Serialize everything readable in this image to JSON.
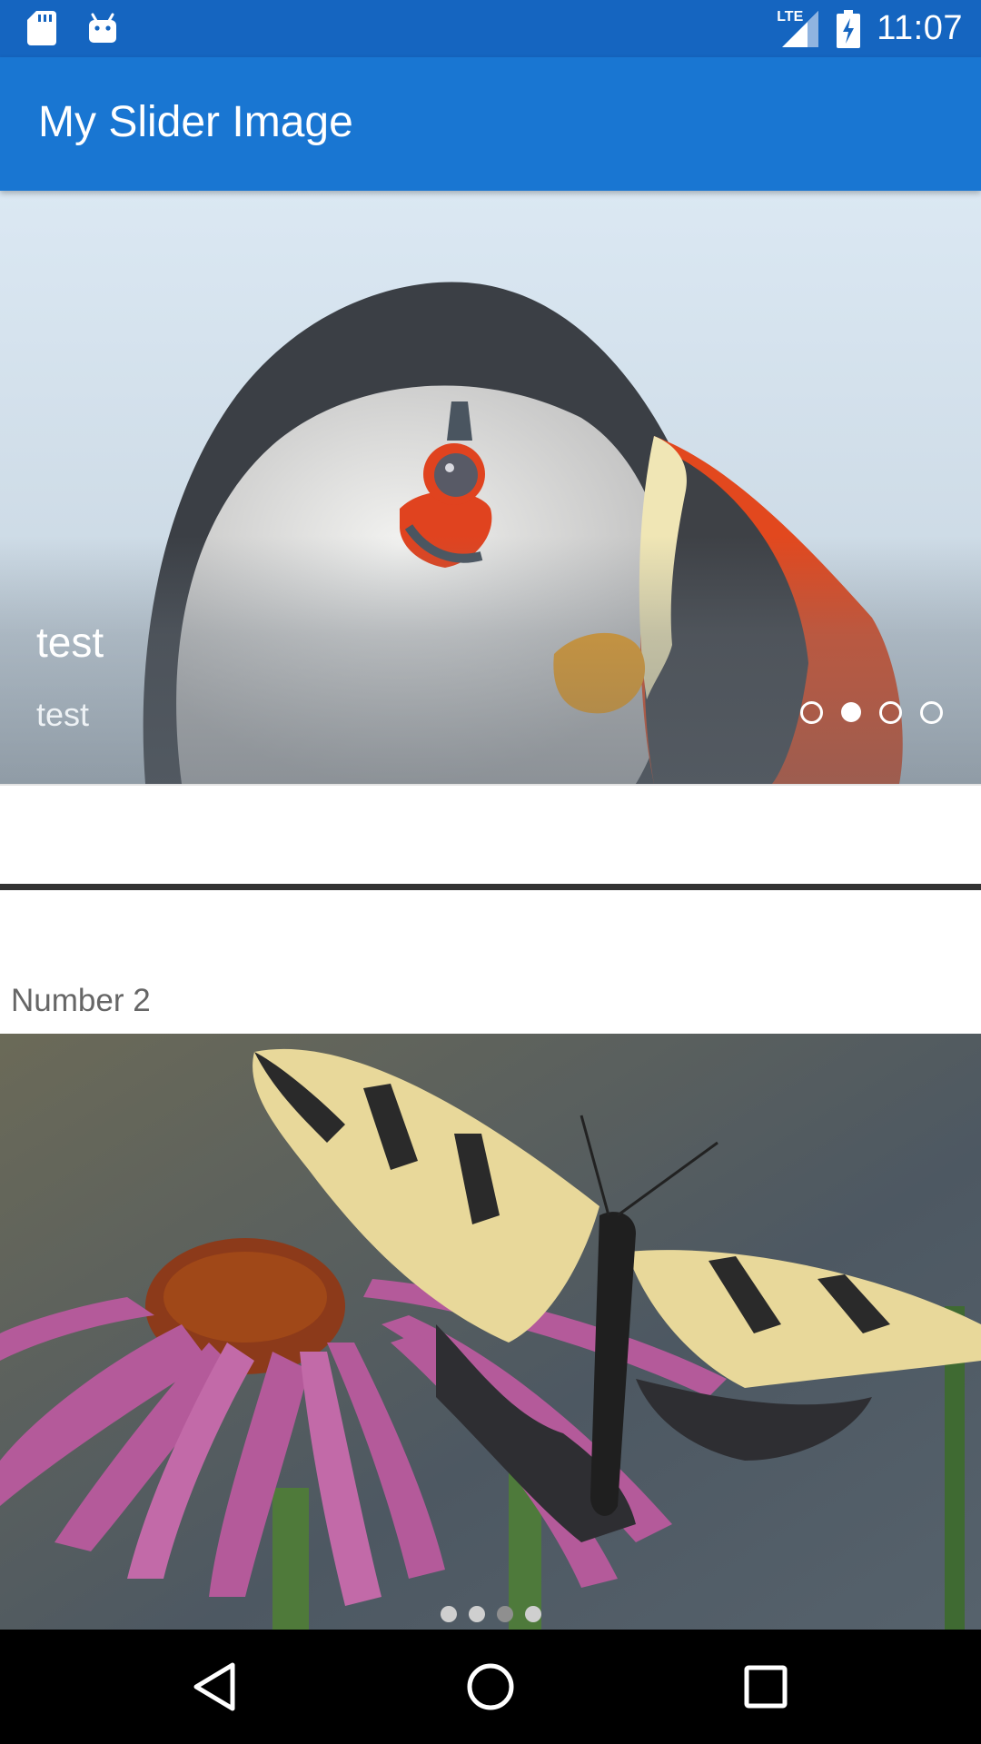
{
  "status_bar": {
    "time": "11:07",
    "network": "LTE",
    "icons": [
      "sd-card-icon",
      "android-icon",
      "signal-icon",
      "battery-charging-icon"
    ]
  },
  "app_bar": {
    "title": "My Slider Image"
  },
  "slider1": {
    "image": "puffin-photo",
    "caption_title": "test",
    "caption_description": "test",
    "indicator_count": 4,
    "active_index": 1
  },
  "section2": {
    "label": "Number 2"
  },
  "slider2": {
    "image": "butterfly-on-coneflower-photo",
    "indicator_count": 4,
    "active_index": 2
  },
  "nav_bar": {
    "icons": [
      "back-icon",
      "home-icon",
      "recents-icon"
    ]
  },
  "colors": {
    "status_bar": "#1565c0",
    "app_bar": "#1976d2",
    "nav_bar": "#000000"
  }
}
